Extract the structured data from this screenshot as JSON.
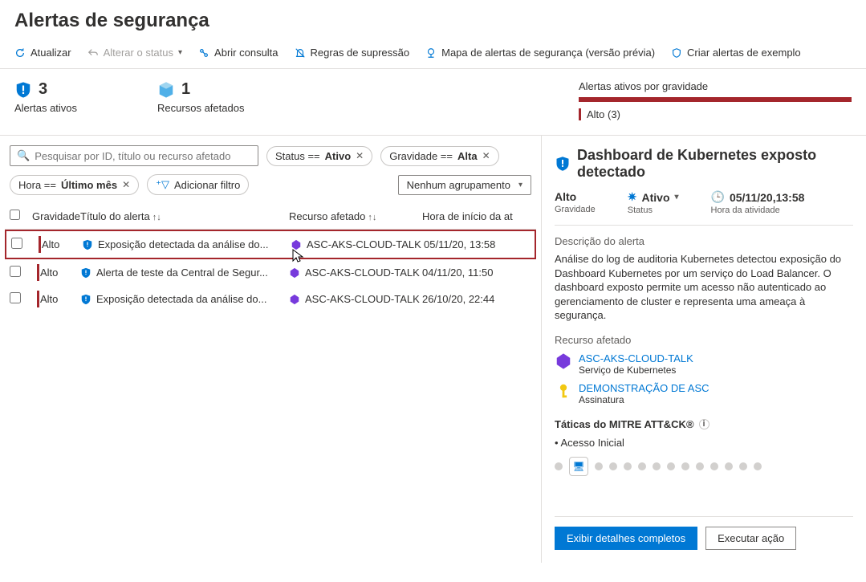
{
  "page": {
    "title": "Alertas de segurança"
  },
  "toolbar": {
    "refresh": "Atualizar",
    "change_status": "Alterar o status",
    "open_query": "Abrir consulta",
    "suppression_rules": "Regras de supressão",
    "alert_map": "Mapa de alertas de segurança (versão prévia)",
    "sample_alerts": "Criar alertas de exemplo"
  },
  "stats": {
    "active_alerts_count": "3",
    "active_alerts_label": "Alertas ativos",
    "affected_resources_count": "1",
    "affected_resources_label": "Recursos afetados"
  },
  "severity_panel": {
    "title": "Alertas ativos por gravidade",
    "line": "Alto (3)"
  },
  "filters": {
    "search_placeholder": "Pesquisar por ID, título ou recurso afetado",
    "status_label": "Status == ",
    "status_value": "Ativo",
    "severity_label": "Gravidade == ",
    "severity_value": "Alta",
    "time_label": "Hora == ",
    "time_value": "Último mês",
    "add_filter": "Adicionar filtro",
    "grouping": "Nenhum agrupamento"
  },
  "columns": {
    "severity": "Gravidade",
    "title": "Título do alerta",
    "resource": "Recurso afetado",
    "time": "Hora de início da at"
  },
  "rows": [
    {
      "severity": "Alto",
      "title": "Exposição detectada da análise do...",
      "resource": "ASC-AKS-CLOUD-TALK",
      "time": "05/11/20, 13:58"
    },
    {
      "severity": "Alto",
      "title": "Alerta de teste da Central de Segur...",
      "resource": "ASC-AKS-CLOUD-TALK",
      "time": "04/11/20, 11:50"
    },
    {
      "severity": "Alto",
      "title": "Exposição detectada da análise do...",
      "resource": "ASC-AKS-CLOUD-TALK",
      "time": "26/10/20, 22:44"
    }
  ],
  "detail": {
    "title": "Dashboard de Kubernetes exposto detectado",
    "severity_value": "Alto",
    "severity_label": "Gravidade",
    "status_value": "Ativo",
    "status_label": "Status",
    "time_value": "05/11/20,13:58",
    "time_label": "Hora da atividade",
    "desc_header": "Descrição do alerta",
    "desc_text": "Análise do log de auditoria Kubernetes detectou exposição do Dashboard Kubernetes por um serviço do Load Balancer. O dashboard exposto permite um acesso não autenticado ao gerenciamento de cluster e representa uma ameaça à segurança.",
    "affected_header": "Recurso afetado",
    "resources": [
      {
        "name": "ASC-AKS-CLOUD-TALK",
        "type": "Serviço de Kubernetes",
        "icon": "k8s"
      },
      {
        "name": "DEMONSTRAÇÃO DE ASC",
        "type": "Assinatura",
        "icon": "key"
      }
    ],
    "mitre_header": "Táticas do MITRE ATT&CK®",
    "mitre_item": "Acesso Inicial",
    "btn_full": "Exibir detalhes completos",
    "btn_action": "Executar ação"
  }
}
